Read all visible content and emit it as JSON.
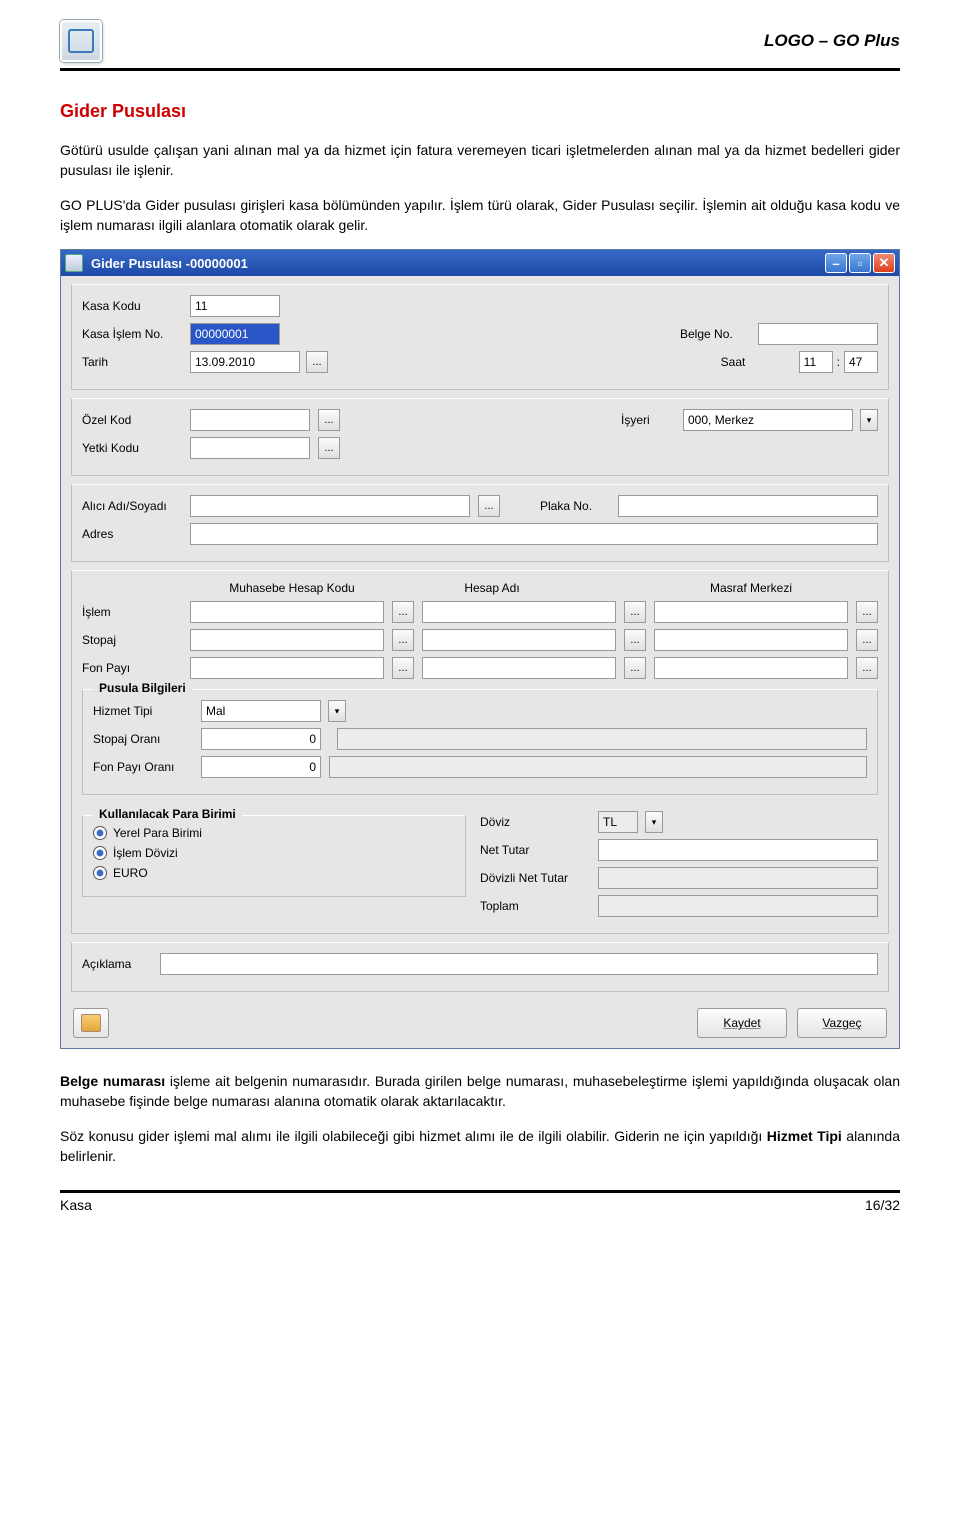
{
  "header": {
    "brand": "LOGO – GO Plus"
  },
  "section_title": "Gider Pusulası",
  "para1": "Götürü usulde çalışan yani alınan mal ya da hizmet için fatura veremeyen ticari işletmelerden alınan mal ya da hizmet bedelleri gider pusulası ile işlenir.",
  "para2": "GO PLUS'da Gider pusulası girişleri kasa bölümünden yapılır. İşlem türü olarak, Gider Pusulası seçilir. İşlemin ait olduğu kasa kodu ve işlem numarası ilgili alanlara otomatik olarak gelir.",
  "para3_a": "Belge numarası",
  "para3_b": " işleme ait belgenin numarasıdır. Burada girilen belge numarası, muhasebeleştirme işlemi yapıldığında oluşacak olan muhasebe fişinde belge numarası alanına otomatik olarak aktarılacaktır.",
  "para4_a": "Söz konusu gider işlemi mal alımı ile ilgili olabileceği gibi hizmet alımı ile de ilgili olabilir. Giderin ne için yapıldığı ",
  "para4_b": "Hizmet Tipi",
  "para4_c": " alanında belirlenir.",
  "dialog": {
    "title": "Gider Pusulası -00000001",
    "labels": {
      "kasa_kodu": "Kasa Kodu",
      "kasa_islem_no": "Kasa İşlem No.",
      "belge_no": "Belge No.",
      "tarih": "Tarih",
      "saat": "Saat",
      "ozel_kod": "Özel Kod",
      "yetki_kodu": "Yetki Kodu",
      "isyeri": "İşyeri",
      "alici": "Alıcı Adı/Soyadı",
      "plaka": "Plaka No.",
      "adres": "Adres",
      "muh_kodu": "Muhasebe Hesap Kodu",
      "hesap_adi": "Hesap Adı",
      "masraf": "Masraf Merkezi",
      "islem": "İşlem",
      "stopaj": "Stopaj",
      "fon_payi": "Fon Payı",
      "pusula": "Pusula Bilgileri",
      "hizmet_tipi": "Hizmet Tipi",
      "stopaj_orani": "Stopaj Oranı",
      "fon_payi_orani": "Fon Payı Oranı",
      "kull_para": "Kullanılacak Para Birimi",
      "yerel": "Yerel Para Birimi",
      "islem_dovizi": "İşlem Dövizi",
      "euro": "EURO",
      "doviz": "Döviz",
      "net_tutar": "Net Tutar",
      "dovizli_net": "Dövizli Net Tutar",
      "toplam": "Toplam",
      "aciklama": "Açıklama",
      "kaydet": "Kaydet",
      "vazgec": "Vazgeç"
    },
    "values": {
      "kasa_kodu": "11",
      "kasa_islem_no": "00000001",
      "tarih": "13.09.2010",
      "saat_h": "11",
      "saat_m": "47",
      "isyeri": "000, Merkez",
      "hizmet_tipi": "Mal",
      "stopaj_orani": "0",
      "fon_payi_orani": "0",
      "doviz": "TL"
    }
  },
  "footer": {
    "left": "Kasa",
    "right": "16/32"
  }
}
